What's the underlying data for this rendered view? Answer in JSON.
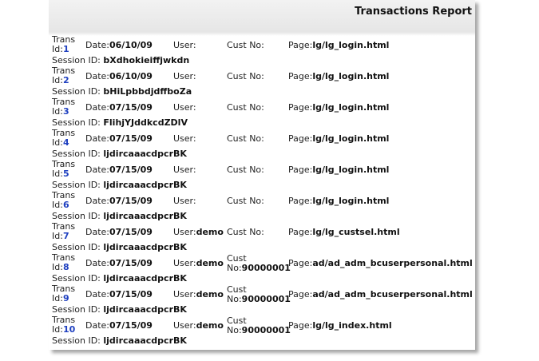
{
  "report": {
    "title": "Transactions Report",
    "labels": {
      "trans_id": "Trans Id:",
      "date": "Date:",
      "user": "User:",
      "cust_no": "Cust No:",
      "page": "Page:",
      "session_id": "Session ID: "
    },
    "transactions": [
      {
        "id": "1",
        "date": "06/10/09",
        "user": "",
        "cust_no": "",
        "page": "lg/lg_login.html",
        "session": "bXdhokieiffjwkdn"
      },
      {
        "id": "2",
        "date": "06/10/09",
        "user": "",
        "cust_no": "",
        "page": "lg/lg_login.html",
        "session": "bHiLpbbdjdffboZa"
      },
      {
        "id": "3",
        "date": "07/15/09",
        "user": "",
        "cust_no": "",
        "page": "lg/lg_login.html",
        "session": "FlihjYJddkcdZDlV"
      },
      {
        "id": "4",
        "date": "07/15/09",
        "user": "",
        "cust_no": "",
        "page": "lg/lg_login.html",
        "session": "ljdircaaacdpcrBK"
      },
      {
        "id": "5",
        "date": "07/15/09",
        "user": "",
        "cust_no": "",
        "page": "lg/lg_login.html",
        "session": "ljdircaaacdpcrBK"
      },
      {
        "id": "6",
        "date": "07/15/09",
        "user": "",
        "cust_no": "",
        "page": "lg/lg_login.html",
        "session": "ljdircaaacdpcrBK"
      },
      {
        "id": "7",
        "date": "07/15/09",
        "user": "demo",
        "cust_no": "",
        "page": "lg/lg_custsel.html",
        "session": "ljdircaaacdpcrBK"
      },
      {
        "id": "8",
        "date": "07/15/09",
        "user": "demo",
        "cust_no": "90000001",
        "page": "ad/ad_adm_bcuserpersonal.html",
        "session": "ljdircaaacdpcrBK"
      },
      {
        "id": "9",
        "date": "07/15/09",
        "user": "demo",
        "cust_no": "90000001",
        "page": "ad/ad_adm_bcuserpersonal.html",
        "session": "ljdircaaacdpcrBK"
      },
      {
        "id": "10",
        "date": "07/15/09",
        "user": "demo",
        "cust_no": "90000001",
        "page": "lg/lg_index.html",
        "session": "ljdircaaacdpcrBK"
      }
    ]
  }
}
